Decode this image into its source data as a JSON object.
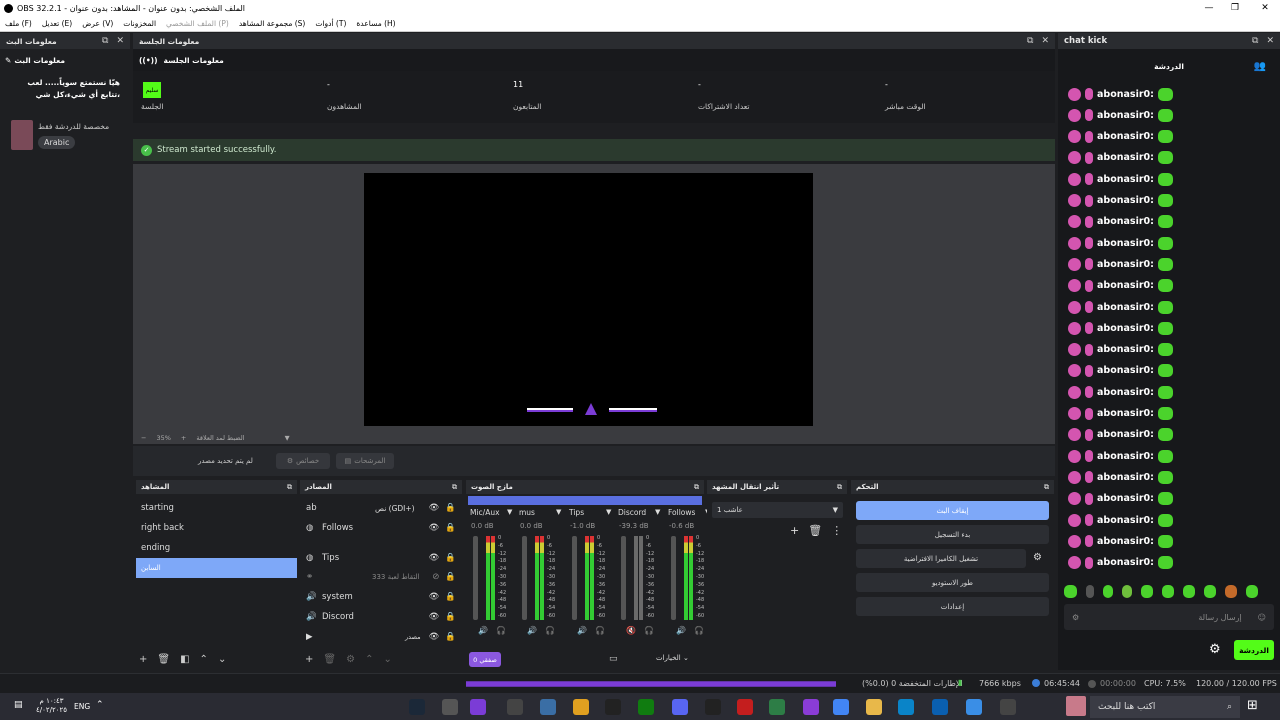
{
  "window": {
    "title": "OBS 32.2.1 - الملف الشخصي: بدون عنوان - المشاهد: بدون عنوان"
  },
  "menu": [
    "ملف (F)",
    "تعديل (E)",
    "عرض (V)",
    "المخزونات",
    "الملف الشخصي (P)",
    "مجموعة المشاهد (S)",
    "أدوات (T)",
    "مساعدة (H)"
  ],
  "left_dock": {
    "title": "معلومات البث",
    "header": "معلومات البث",
    "stream_title": "هيّا نستمتع سوياً..... لعب ،تتابع أي شيء،كل شي",
    "subtitle": "مخصصة للدردشة فقط",
    "language_tag": "Arabic"
  },
  "session_dock": {
    "title": "معلومات الجلسة",
    "header": "معلومات الجلسة",
    "live_badge": "سليم",
    "stats": [
      {
        "label": "الجلسة",
        "value": ""
      },
      {
        "label": "المشاهدون",
        "value": "-"
      },
      {
        "label": "المتابعون",
        "value": "11"
      },
      {
        "label": "تعداد الاشتراكات",
        "value": "-"
      },
      {
        "label": "الوقت مباشر",
        "value": "-"
      }
    ],
    "banner": "Stream started successfully."
  },
  "preview": {
    "zoom": "35%",
    "toolbar_label": "الضبط لمد العلاقة",
    "no_source": "لم يتم تحديد مصدر",
    "properties_btn": "خصائص",
    "filters_btn": "المرشحات"
  },
  "scenes": {
    "title": "المشاهد",
    "items": [
      "starting",
      "right back",
      "ending",
      "السابن"
    ],
    "selected_index": 3
  },
  "sources": {
    "title": "المصادر",
    "items": [
      "نص (GDI+)",
      "Follows",
      "Tips",
      "333 التقاط لعبة",
      "system",
      "Discord",
      "مصدر"
    ]
  },
  "mixer": {
    "title": "مازج الصوت",
    "channels": [
      {
        "name": "Mic/Aux",
        "db": "0.0 dB",
        "muted": false
      },
      {
        "name": "mus",
        "db": "0.0 dB",
        "muted": false
      },
      {
        "name": "Tips",
        "db": "-1.0 dB",
        "muted": false
      },
      {
        "name": "Discord",
        "db": "-39.3 dB",
        "muted": true
      },
      {
        "name": "Follows",
        "db": "-0.6 dB",
        "muted": false
      }
    ],
    "scale": [
      "0",
      "-6",
      "-12",
      "-18",
      "-24",
      "-30",
      "-36",
      "-42",
      "-48",
      "-54",
      "-60"
    ],
    "purple_btn": "صفقي 0",
    "options_label": "الخيارات"
  },
  "transitions": {
    "title": "تأثير انتقال المشهد",
    "selected": "عاشب 1"
  },
  "controls": {
    "title": "التحكم",
    "buttons": [
      "إيقاف البث",
      "بدء التسجيل",
      "تشغيل الكاميرا الافتراضية",
      "طور الاستوديو",
      "إعدادات"
    ]
  },
  "chat": {
    "title": "chat kick",
    "header": "الدردشة",
    "username": "abonasir0:",
    "message_count": 23,
    "input_placeholder": "إرسال رسالة",
    "send_label": "الدردشة"
  },
  "statusbar": {
    "dropped": "الإطارات المتخفضة 0 (0.0%)",
    "bitrate": "7666 kbps",
    "live_time": "06:45:44",
    "rec_time": "00:00:00",
    "cpu": "CPU: 7.5%",
    "fps": "120.00 / 120.00 FPS"
  },
  "taskbar": {
    "search": "اكتب هنا للبحث",
    "time": "١٠:٤٣ م",
    "date": "٤/٠٢/٢٠٢٥",
    "lang": "ENG"
  },
  "colors": {
    "accent_green": "#53fc18",
    "selected_blue": "#7ea8f8",
    "purple": "#7b3cd6"
  }
}
